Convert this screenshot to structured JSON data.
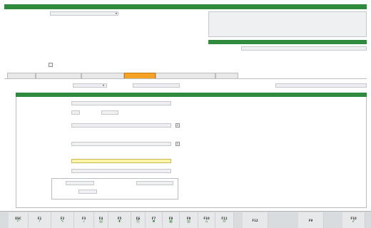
{
  "window": {
    "title": ""
  },
  "prescripteur": {
    "section_title": "",
    "type_label": "",
    "type_value": "",
    "nom_label": "",
    "nom_value": "",
    "tel_label": "",
    "fax_label": "",
    "comment_placeholder": "",
    "identifiant_label": "",
    "identifiant_value": "",
    "prescripteur_bloque_label": ""
  },
  "responsable": {
    "section_title": "",
    "name_label": "",
    "tel_label": "",
    "fax_label": "",
    "portable_label": ""
  },
  "tabs": [
    {
      "label": ""
    },
    {
      "label": ""
    },
    {
      "label": ""
    },
    {
      "label": ""
    },
    {
      "label": ""
    },
    {
      "label": ""
    }
  ],
  "filter_row": {
    "mode_label": "",
    "mode_value": "",
    "par_label": "",
    "notes_label": ""
  },
  "reprise": {
    "section_title": "",
    "reference_label": "",
    "reference_value": "",
    "code_label": "",
    "code_value": "",
    "code_extra": "",
    "code_extra2": "",
    "ville_principale_label": "",
    "ville_principale_value": "",
    "ville_principale_sub": "",
    "ville_service_label": "",
    "ville_service_sub": "",
    "numero_label": "",
    "numero_value": "",
    "identifiant_label": "",
    "identifiant_value": "",
    "acces_label": "",
    "acces_label2": "",
    "login_label": "",
    "mdp_label": "",
    "port_label": "",
    "port_value": ""
  },
  "function_keys": [
    {
      "key": "ESC",
      "glyph": "↶",
      "text": ""
    },
    {
      "key": "F1",
      "glyph": "?",
      "text": ""
    },
    {
      "key": "F2",
      "glyph": "✎",
      "text": ""
    },
    {
      "key": "F3",
      "glyph": "⌕",
      "text": ""
    },
    {
      "key": "F4",
      "glyph": "▤",
      "text": ""
    },
    {
      "key": "F5",
      "glyph": "✚",
      "text": ""
    },
    {
      "key": "F6",
      "glyph": "⎘",
      "text": ""
    },
    {
      "key": "F7",
      "glyph": "✖",
      "text": ""
    },
    {
      "key": "F8",
      "glyph": "▦",
      "text": ""
    },
    {
      "key": "F9",
      "glyph": "▥",
      "text": ""
    },
    {
      "key": "F10",
      "glyph": "⌂",
      "text": ""
    },
    {
      "key": "F11",
      "glyph": "✉",
      "text": ""
    },
    {
      "key": "F12",
      "glyph": "",
      "text": ""
    },
    {
      "key": "F9",
      "glyph": "",
      "text": ""
    },
    {
      "key": "F10",
      "glyph": "✔",
      "text": ""
    }
  ]
}
